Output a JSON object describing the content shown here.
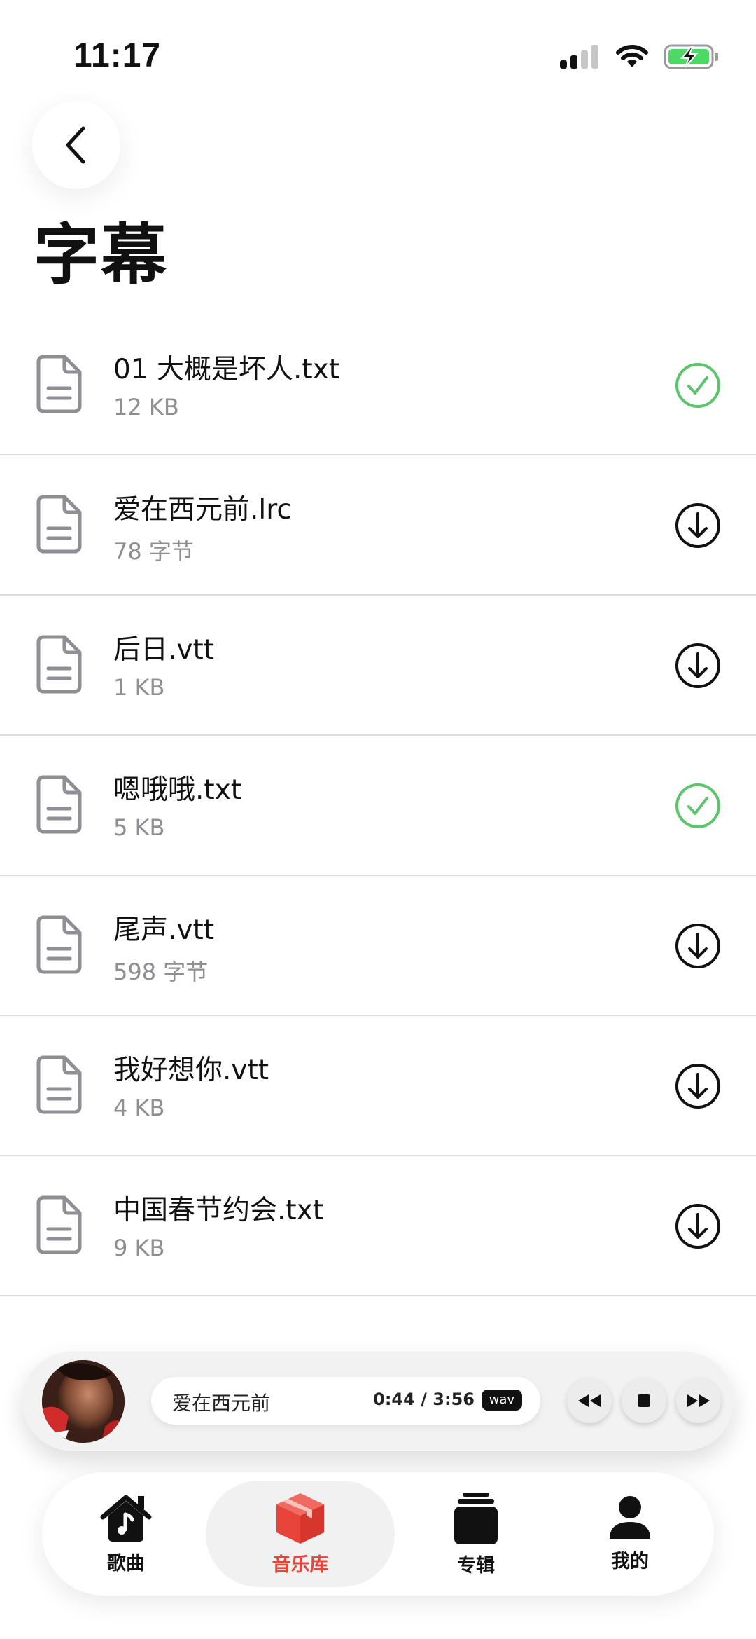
{
  "status_bar": {
    "time": "11:17"
  },
  "header": {
    "title": "字幕"
  },
  "files": [
    {
      "name": "01 大概是坏人.txt",
      "size": "12 KB",
      "status": "downloaded",
      "status_icon": "check-circle-icon"
    },
    {
      "name": "爱在西元前.lrc",
      "size": "78 字节",
      "status": "download",
      "status_icon": "download-circle-icon"
    },
    {
      "name": "后日.vtt",
      "size": "1 KB",
      "status": "download",
      "status_icon": "download-circle-icon"
    },
    {
      "name": "嗯哦哦.txt",
      "size": "5 KB",
      "status": "downloaded",
      "status_icon": "check-circle-icon"
    },
    {
      "name": "尾声.vtt",
      "size": "598 字节",
      "status": "download",
      "status_icon": "download-circle-icon"
    },
    {
      "name": "我好想你.vtt",
      "size": "4 KB",
      "status": "download",
      "status_icon": "download-circle-icon"
    },
    {
      "name": "中国春节约会.txt",
      "size": "9 KB",
      "status": "download",
      "status_icon": "download-circle-icon"
    }
  ],
  "player": {
    "track_title": "爱在西元前",
    "time": "0:44 / 3:56",
    "format": "wav"
  },
  "tabs": [
    {
      "label": "歌曲",
      "icon": "home-music-icon",
      "active": false
    },
    {
      "label": "音乐库",
      "icon": "box-icon",
      "active": true
    },
    {
      "label": "专辑",
      "icon": "album-stack-icon",
      "active": false
    },
    {
      "label": "我的",
      "icon": "person-icon",
      "active": false
    }
  ],
  "colors": {
    "accent": "#e8443a",
    "success": "#5cc46a",
    "text": "#111111",
    "secondary": "#8e8e93"
  }
}
